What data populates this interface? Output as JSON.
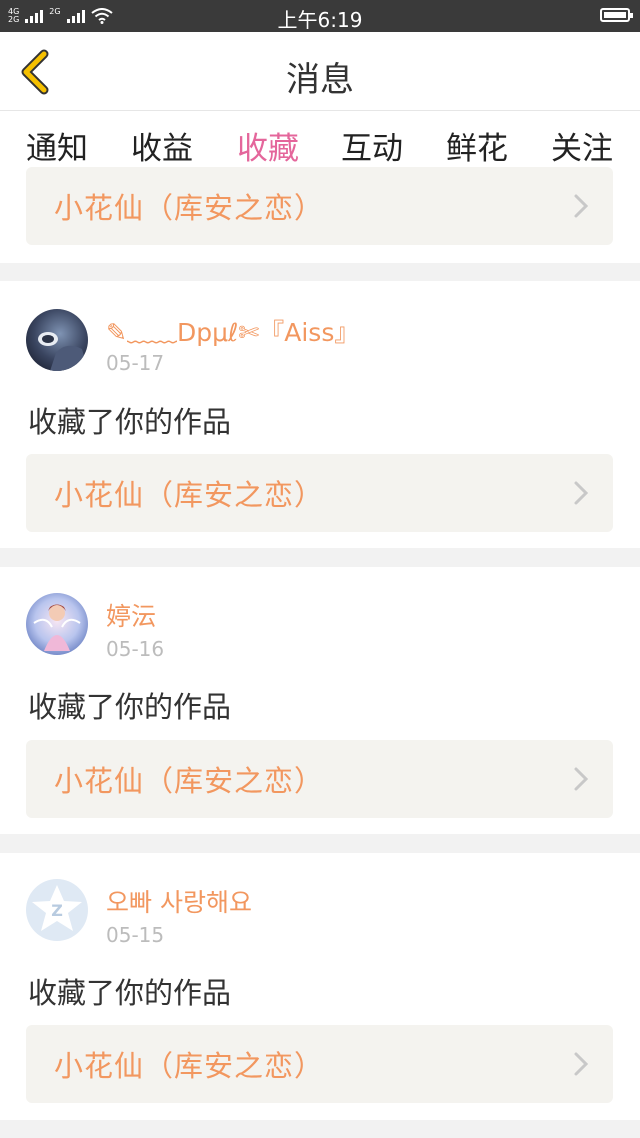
{
  "status_bar": {
    "network_top": "4G",
    "network_bottom": "2G",
    "network_top2": "2G",
    "time": "上午6:19"
  },
  "header": {
    "title": "消息"
  },
  "tabs": [
    {
      "label": "通知"
    },
    {
      "label": "收益"
    },
    {
      "label": "收藏",
      "active": true
    },
    {
      "label": "互动"
    },
    {
      "label": "鲜花"
    },
    {
      "label": "关注"
    }
  ],
  "partial_item": {
    "work_title": "小花仙（库安之恋）"
  },
  "items": [
    {
      "user": "✎﹏﹏Dpμℓ✄『Aiss』",
      "date": "05-17",
      "action": "收藏了你的作品",
      "work_title": "小花仙（库安之恋）",
      "avatar_icon": "avatar-dark-icon"
    },
    {
      "user": "婷沄",
      "date": "05-16",
      "action": "收藏了你的作品",
      "work_title": "小花仙（库安之恋）",
      "avatar_icon": "avatar-fairy-icon"
    },
    {
      "user": "오빠 사랑해요",
      "date": "05-15",
      "action": "收藏了你的作品",
      "work_title": "小花仙（库安之恋）",
      "avatar_icon": "avatar-default-icon"
    }
  ],
  "colors": {
    "accent": "#e4669b",
    "name": "#f2975f",
    "back_arrow": "#f5c000"
  }
}
